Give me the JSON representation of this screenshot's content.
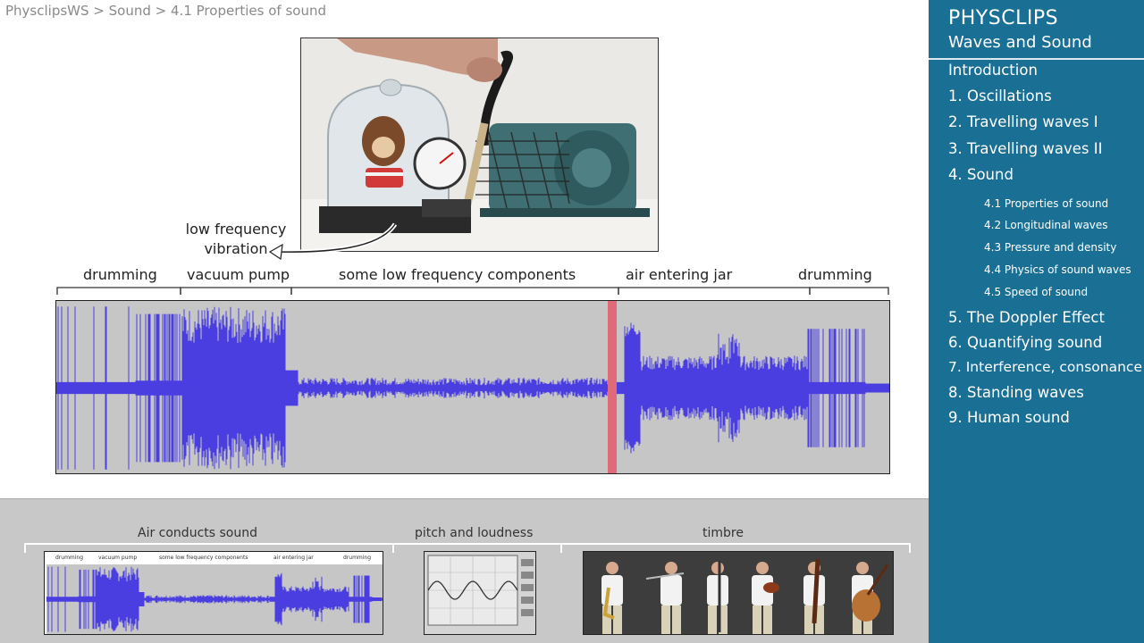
{
  "breadcrumb": {
    "items": [
      "PhysclipsWS",
      "Sound",
      "4.1 Properties of sound"
    ],
    "separator": ">"
  },
  "photo": {
    "annotation_line1": "low frequency",
    "annotation_line2": "vibration"
  },
  "waveform": {
    "segments": [
      "drumming",
      "vacuum pump",
      "some low frequency components",
      "air entering jar",
      "drumming"
    ],
    "wave_color": "#4a3ee0",
    "marker_color": "#e06a7a",
    "background_color": "#c6c6c6"
  },
  "thumbnails": {
    "air": {
      "label": "Air conducts sound",
      "mini_segments": [
        "drumming",
        "vacuum pump",
        "some low frequency components",
        "air entering jar",
        "drumming"
      ]
    },
    "pitch": {
      "label": "pitch and loudness"
    },
    "timbre": {
      "label": "timbre"
    }
  },
  "sidebar": {
    "title": "PHYSCLIPS",
    "subtitle": "Waves and Sound",
    "background_color": "#1a6f95",
    "items": [
      {
        "label": "Introduction"
      },
      {
        "label": "1. Oscillations"
      },
      {
        "label": "2. Travelling waves I"
      },
      {
        "label": "3. Travelling waves II"
      },
      {
        "label": "4. Sound"
      },
      {
        "label": "5. The Doppler Effect"
      },
      {
        "label": "6. Quantifying sound"
      },
      {
        "label": "7. Interference, consonance"
      },
      {
        "label": "8. Standing waves"
      },
      {
        "label": "9. Human sound"
      }
    ],
    "subitems": [
      {
        "label": "4.1 Properties of sound"
      },
      {
        "label": "4.2 Longitudinal waves"
      },
      {
        "label": "4.3 Pressure and density"
      },
      {
        "label": "4.4 Physics of sound waves"
      },
      {
        "label": "4.5 Speed of sound"
      }
    ]
  }
}
